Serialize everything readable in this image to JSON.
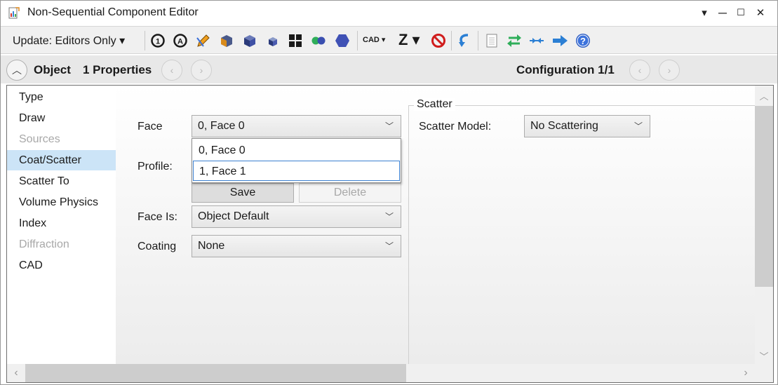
{
  "window": {
    "title": "Non-Sequential Component Editor",
    "controls": {
      "menu": "▾",
      "minimize": "—",
      "maximize": "☐",
      "close": "✕"
    }
  },
  "toolbar": {
    "update_label": "Update: Editors Only ▾",
    "cad_label": "CAD ▾",
    "z_label": "Z ▾",
    "icons": [
      "refresh-1-icon",
      "refresh-all-icon",
      "edit-pencil-icon",
      "solid-model-icon",
      "shaded-cube-icon",
      "small-cube-icon",
      "grid-icon",
      "dots-icon",
      "hexagon-icon",
      "no-entry-icon",
      "undo-arrow-icon",
      "notes-icon",
      "swap-arrows-icon",
      "ray-icon",
      "next-arrow-icon",
      "help-icon"
    ]
  },
  "header": {
    "object_label": "Object",
    "properties_label": "1 Properties",
    "configuration_label": "Configuration 1/1"
  },
  "nav": {
    "items": [
      {
        "label": "Type",
        "state": "normal"
      },
      {
        "label": "Draw",
        "state": "normal"
      },
      {
        "label": "Sources",
        "state": "disabled"
      },
      {
        "label": "Coat/Scatter",
        "state": "selected"
      },
      {
        "label": "Scatter To",
        "state": "normal"
      },
      {
        "label": "Volume Physics",
        "state": "normal"
      },
      {
        "label": "Index",
        "state": "normal"
      },
      {
        "label": "Diffraction",
        "state": "disabled"
      },
      {
        "label": "CAD",
        "state": "normal"
      }
    ]
  },
  "form": {
    "face_label": "Face",
    "face_value": "0, Face 0",
    "face_options": [
      "0, Face 0",
      "1, Face 1"
    ],
    "profile_label": "Profile:",
    "save_label": "Save",
    "delete_label": "Delete",
    "face_is_label": "Face Is:",
    "face_is_value": "Object Default",
    "coating_label": "Coating",
    "coating_value": "None"
  },
  "scatter": {
    "group_title": "Scatter",
    "model_label": "Scatter Model:",
    "model_value": "No Scattering"
  },
  "colors": {
    "selected_nav_bg": "#cce4f7",
    "accent_border": "#3c80d0"
  }
}
